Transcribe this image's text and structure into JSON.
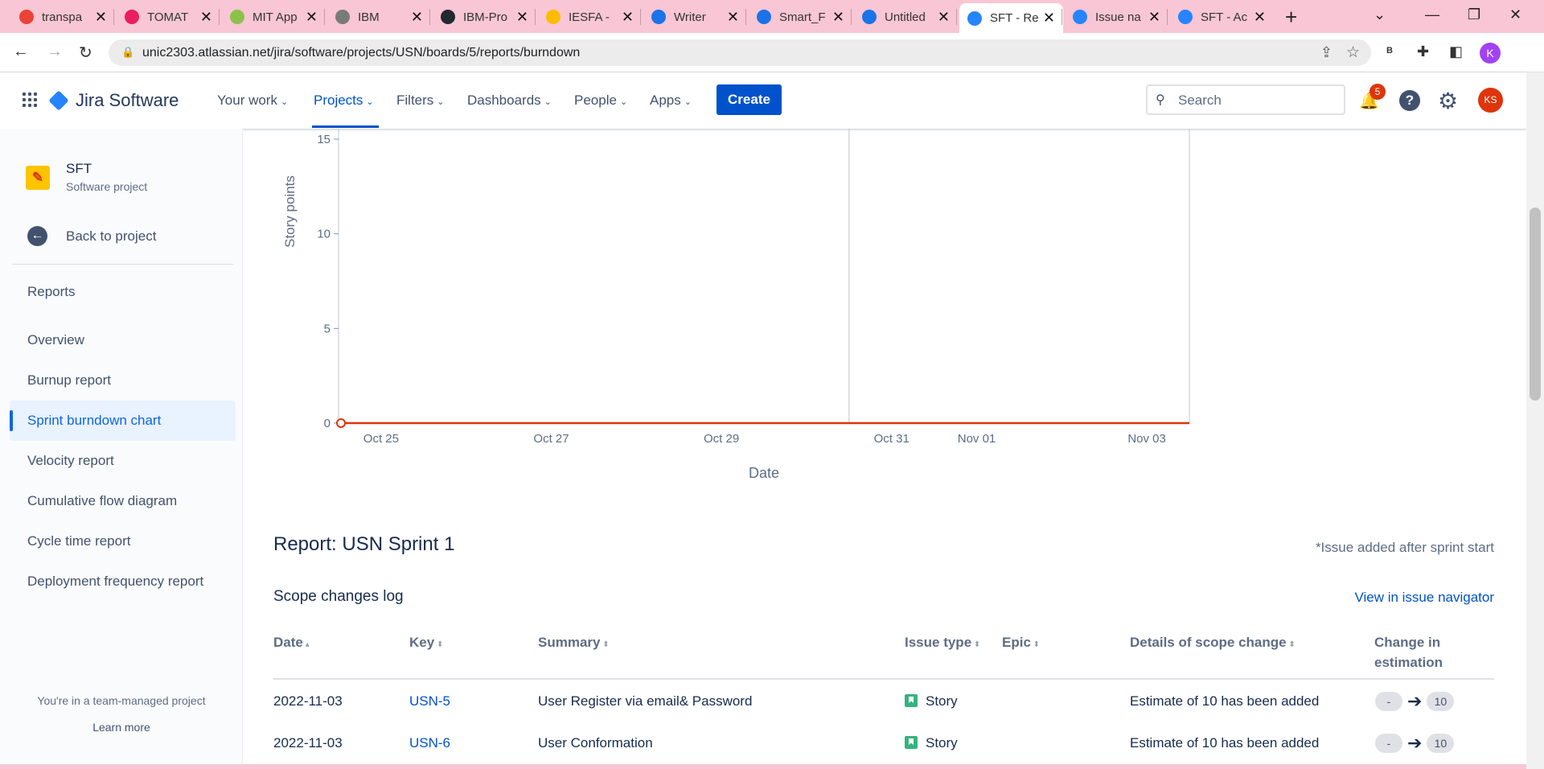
{
  "browser": {
    "tabs": [
      {
        "title": "transpa",
        "color": "#ea4335"
      },
      {
        "title": "TOMAT",
        "color": "#e91e63"
      },
      {
        "title": "MIT App",
        "color": "#8bc34a"
      },
      {
        "title": "IBM",
        "color": "#7a7a7a"
      },
      {
        "title": "IBM-Pro",
        "color": "#24292f"
      },
      {
        "title": "IESFA -",
        "color": "#fbbc04"
      },
      {
        "title": "Writer",
        "color": "#1a73e8"
      },
      {
        "title": "Smart_F",
        "color": "#1a73e8"
      },
      {
        "title": "Untitled",
        "color": "#1a73e8"
      },
      {
        "title": "SFT - Re",
        "color": "#2684ff",
        "active": true
      },
      {
        "title": "Issue na",
        "color": "#2684ff"
      },
      {
        "title": "SFT - Ac",
        "color": "#2684ff"
      }
    ],
    "url": "unic2303.atlassian.net/jira/software/projects/USN/boards/5/reports/burndown",
    "profile_initial": "K",
    "ext_label": "B"
  },
  "jira": {
    "product": "Jira Software",
    "nav": [
      "Your work",
      "Projects",
      "Filters",
      "Dashboards",
      "People",
      "Apps"
    ],
    "create_label": "Create",
    "search_placeholder": "Search",
    "notifications": "5",
    "avatar": "KS"
  },
  "sidebar": {
    "project_name": "SFT",
    "project_type": "Software project",
    "back_label": "Back to project",
    "section": "Reports",
    "items": [
      "Overview",
      "Burnup report",
      "Sprint burndown chart",
      "Velocity report",
      "Cumulative flow diagram",
      "Cycle time report",
      "Deployment frequency report"
    ],
    "active_index": 2,
    "team_note": "You're in a team-managed project",
    "learn_more": "Learn more"
  },
  "chart_data": {
    "type": "line",
    "xlabel": "Date",
    "ylabel": "Story points",
    "yticks": [
      0,
      5,
      10,
      15
    ],
    "ylim": [
      0,
      15
    ],
    "x_ticks": [
      "Oct 25",
      "Oct 27",
      "Oct 29",
      "Oct 31",
      "Nov 01",
      "Nov 03"
    ],
    "xlim": [
      "2022-10-24 12:00",
      "2022-11-03 12:00"
    ],
    "vertical_markers": [
      "2022-10-30 12:00",
      "2022-11-03 12:00"
    ],
    "series": [
      {
        "color": "#de350b",
        "points": [
          [
            "2022-10-24 12:00",
            0
          ],
          [
            "2022-11-03 12:00",
            0
          ]
        ]
      }
    ]
  },
  "report": {
    "title": "Report: USN Sprint 1",
    "added_note": "*Issue added after sprint start",
    "scope_heading": "Scope changes log",
    "issue_nav_link": "View in issue navigator",
    "columns": [
      "Date",
      "Key",
      "Summary",
      "Issue type",
      "Epic",
      "Details of scope change",
      "Change in estimation"
    ],
    "rows": [
      {
        "date": "2022-11-03",
        "key": "USN-5",
        "summary": "User Register via email& Password",
        "type": "Story",
        "epic": "",
        "detail": "Estimate of 10 has been added",
        "from": "-",
        "to": "10"
      },
      {
        "date": "2022-11-03",
        "key": "USN-6",
        "summary": "User Conformation",
        "type": "Story",
        "epic": "",
        "detail": "Estimate of 10 has been added",
        "from": "-",
        "to": "10"
      }
    ]
  }
}
